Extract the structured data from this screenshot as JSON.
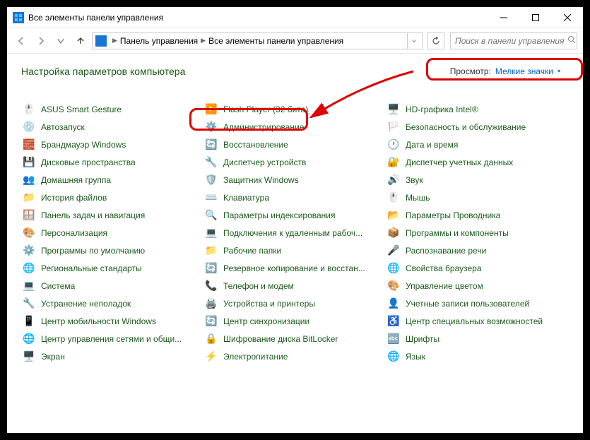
{
  "window": {
    "title": "Все элементы панели управления"
  },
  "breadcrumb": {
    "part1": "Панель управления",
    "part2": "Все элементы панели управления"
  },
  "search": {
    "placeholder": "Поиск в панели управления"
  },
  "page": {
    "title": "Настройка параметров компьютера",
    "view_label": "Просмотр:",
    "view_value": "Мелкие значки"
  },
  "items": [
    {
      "icon": "🖱️",
      "label": "ASUS Smart Gesture"
    },
    {
      "icon": "▶️",
      "label": "Flash Player (32 бита)"
    },
    {
      "icon": "🖥️",
      "label": "HD-графика Intel®"
    },
    {
      "icon": "💿",
      "label": "Автозапуск"
    },
    {
      "icon": "⚙️",
      "label": "Администрирование"
    },
    {
      "icon": "🏳️",
      "label": "Безопасность и обслуживание"
    },
    {
      "icon": "🧱",
      "label": "Брандмауэр Windows"
    },
    {
      "icon": "🔄",
      "label": "Восстановление"
    },
    {
      "icon": "🕐",
      "label": "Дата и время"
    },
    {
      "icon": "💾",
      "label": "Дисковые пространства"
    },
    {
      "icon": "🔧",
      "label": "Диспетчер устройств"
    },
    {
      "icon": "🔐",
      "label": "Диспетчер учетных данных"
    },
    {
      "icon": "👥",
      "label": "Домашняя группа"
    },
    {
      "icon": "🛡️",
      "label": "Защитник Windows"
    },
    {
      "icon": "🔊",
      "label": "Звук"
    },
    {
      "icon": "📁",
      "label": "История файлов"
    },
    {
      "icon": "⌨️",
      "label": "Клавиатура"
    },
    {
      "icon": "🖱️",
      "label": "Мышь"
    },
    {
      "icon": "🪟",
      "label": "Панель задач и навигация"
    },
    {
      "icon": "🔍",
      "label": "Параметры индексирования"
    },
    {
      "icon": "📂",
      "label": "Параметры Проводника"
    },
    {
      "icon": "🎨",
      "label": "Персонализация"
    },
    {
      "icon": "💻",
      "label": "Подключения к удаленным рабоч..."
    },
    {
      "icon": "📦",
      "label": "Программы и компоненты"
    },
    {
      "icon": "⚙️",
      "label": "Программы по умолчанию"
    },
    {
      "icon": "📁",
      "label": "Рабочие папки"
    },
    {
      "icon": "🎤",
      "label": "Распознавание речи"
    },
    {
      "icon": "🌐",
      "label": "Региональные стандарты"
    },
    {
      "icon": "🔄",
      "label": "Резервное копирование и восстан..."
    },
    {
      "icon": "🌐",
      "label": "Свойства браузера"
    },
    {
      "icon": "💻",
      "label": "Система"
    },
    {
      "icon": "📞",
      "label": "Телефон и модем"
    },
    {
      "icon": "🎨",
      "label": "Управление цветом"
    },
    {
      "icon": "🔧",
      "label": "Устранение неполадок"
    },
    {
      "icon": "🖨️",
      "label": "Устройства и принтеры"
    },
    {
      "icon": "👤",
      "label": "Учетные записи пользователей"
    },
    {
      "icon": "📱",
      "label": "Центр мобильности Windows"
    },
    {
      "icon": "🔄",
      "label": "Центр синхронизации"
    },
    {
      "icon": "♿",
      "label": "Центр специальных возможностей"
    },
    {
      "icon": "🌐",
      "label": "Центр управления сетями и общи..."
    },
    {
      "icon": "🔒",
      "label": "Шифрование диска BitLocker"
    },
    {
      "icon": "🔤",
      "label": "Шрифты"
    },
    {
      "icon": "🖥️",
      "label": "Экран"
    },
    {
      "icon": "⚡",
      "label": "Электропитание"
    },
    {
      "icon": "🌐",
      "label": "Язык"
    }
  ]
}
